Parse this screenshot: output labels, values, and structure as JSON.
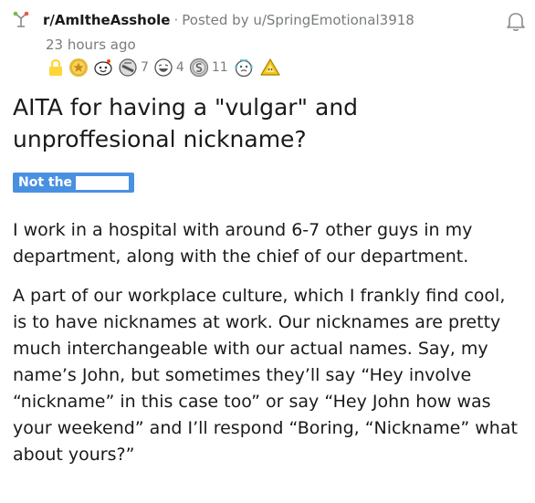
{
  "post": {
    "subreddit": "r/AmItheAsshole",
    "separator": "·",
    "posted_by": "Posted by u/SpringEmotional3918",
    "timestamp": "23 hours ago",
    "awards": [
      {
        "icon": "lock-icon",
        "count": ""
      },
      {
        "icon": "gold-award-icon",
        "count": ""
      },
      {
        "icon": "wholesome-award-icon",
        "count": ""
      },
      {
        "icon": "facepalm-award-icon",
        "count": "7"
      },
      {
        "icon": "laughing-award-icon",
        "count": "4"
      },
      {
        "icon": "silver-award-icon",
        "count": "11"
      },
      {
        "icon": "tearing-up-award-icon",
        "count": ""
      },
      {
        "icon": "gold-triangle-award-icon",
        "count": ""
      }
    ],
    "title": "AITA for having a \"vulgar\" and unproffesional nickname?",
    "flair": "Not the",
    "paragraphs": [
      "I work in a hospital with around 6-7 other guys in my department, along with the chief of our department.",
      "A part of our workplace culture, which I frankly find cool, is to have nicknames at work. Our nicknames are pretty much interchangeable with our actual names. Say, my name’s John, but sometimes they’ll say “Hey involve “nickname” in this case too” or say “Hey John how was your weekend” and I’ll respond “Boring, “Nickname” what about yours?”"
    ]
  },
  "colors": {
    "flair_bg": "#4a90e2",
    "meta_gray": "#787c7e",
    "lock_gold": "#ffd635",
    "text": "#1a1a1b"
  }
}
